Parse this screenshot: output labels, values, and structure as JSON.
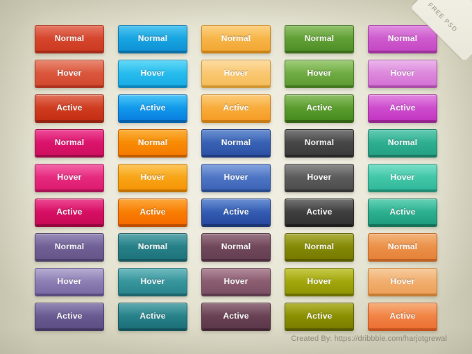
{
  "ribbon": {
    "label": "FREE PSD"
  },
  "footer": {
    "credit": "Created By: https://dribbble.com/harjotgrewal"
  },
  "background": {
    "color": "#eeecdf",
    "edge_color": "#d3d1bb"
  },
  "states": [
    "Normal",
    "Hover",
    "Active"
  ],
  "columns": [
    {
      "name": "red",
      "states": {
        "normal": "Normal",
        "hover": "Hover",
        "active": "Active"
      },
      "colors": {
        "normal_top": "#df5339",
        "normal_bottom": "#cc3a21",
        "normal_base": "#a52c18",
        "hover_top": "#e2664a",
        "hover_bottom": "#d2492f",
        "hover_base": "#ab3320",
        "active_top": "#d94a2c",
        "active_bottom": "#c42f14",
        "active_base": "#962310"
      }
    },
    {
      "name": "sky-blue",
      "states": {
        "normal": "Normal",
        "hover": "Hover",
        "active": "Active"
      },
      "colors": {
        "normal_top": "#21b6ec",
        "normal_bottom": "#0f93d6",
        "normal_base": "#0b6fa6",
        "hover_top": "#36cdf5",
        "hover_bottom": "#19ace6",
        "hover_base": "#0e84b8",
        "active_top": "#19b4f5",
        "active_bottom": "#0a7fe0",
        "active_base": "#0661ab"
      }
    },
    {
      "name": "amber",
      "states": {
        "normal": "Normal",
        "hover": "Hover",
        "active": "Active"
      },
      "colors": {
        "normal_top": "#fbc461",
        "normal_bottom": "#f2a732",
        "normal_base": "#c98219",
        "hover_top": "#fcd287",
        "hover_bottom": "#f6bd5c",
        "hover_base": "#cf9633",
        "active_top": "#fbbd55",
        "active_bottom": "#f59c25",
        "active_base": "#c87a14"
      }
    },
    {
      "name": "green",
      "states": {
        "normal": "Normal",
        "hover": "Hover",
        "active": "Active"
      },
      "colors": {
        "normal_top": "#74b143",
        "normal_bottom": "#4e8f27",
        "normal_base": "#3a6c1b",
        "hover_top": "#85bf55",
        "hover_bottom": "#5d9b33",
        "hover_base": "#437722",
        "active_top": "#6fae3d",
        "active_bottom": "#478b1f",
        "active_base": "#346314"
      }
    },
    {
      "name": "orchid",
      "states": {
        "normal": "Normal",
        "hover": "Hover",
        "active": "Active"
      },
      "colors": {
        "normal_top": "#d86fd8",
        "normal_bottom": "#c548c5",
        "normal_base": "#9b339b",
        "hover_top": "#e5a0e5",
        "hover_bottom": "#d572d5",
        "hover_base": "#a94da9",
        "active_top": "#d964d9",
        "active_bottom": "#c336c3",
        "active_base": "#96248f"
      }
    },
    {
      "name": "magenta",
      "states": {
        "normal": "Normal",
        "hover": "Hover",
        "active": "Active"
      },
      "colors": {
        "normal_top": "#e8197a",
        "normal_bottom": "#cf0f5f",
        "normal_base": "#9d0a47",
        "hover_top": "#ef3b8f",
        "hover_bottom": "#dd1b6f",
        "hover_base": "#a81255",
        "active_top": "#e61574",
        "active_bottom": "#c80a55",
        "active_base": "#94063d"
      }
    },
    {
      "name": "orange",
      "states": {
        "normal": "Normal",
        "hover": "Hover",
        "active": "Active"
      },
      "colors": {
        "normal_top": "#fb9b08",
        "normal_bottom": "#f57c00",
        "normal_base": "#c05c00",
        "hover_top": "#fcb62c",
        "hover_bottom": "#f59505",
        "hover_base": "#c17200",
        "active_top": "#fb8f05",
        "active_bottom": "#f66c00",
        "active_base": "#bd4e00"
      }
    },
    {
      "name": "navy-blue",
      "states": {
        "normal": "Normal",
        "hover": "Hover",
        "active": "Active"
      },
      "colors": {
        "normal_top": "#4473c4",
        "normal_bottom": "#2c51a5",
        "normal_base": "#1f3b7d",
        "hover_top": "#628ad4",
        "hover_bottom": "#3c63b6",
        "hover_base": "#2a4a8c",
        "active_top": "#4070c6",
        "active_bottom": "#27499f",
        "active_base": "#1a3572"
      }
    },
    {
      "name": "charcoal",
      "states": {
        "normal": "Normal",
        "hover": "Hover",
        "active": "Active"
      },
      "colors": {
        "normal_top": "#545454",
        "normal_bottom": "#3b3b3b",
        "normal_base": "#272727",
        "hover_top": "#6b6b6b",
        "hover_bottom": "#4d4d4d",
        "hover_base": "#333333",
        "active_top": "#4c4c4c",
        "active_bottom": "#323232",
        "active_base": "#1e1e1e"
      }
    },
    {
      "name": "teal-mint",
      "states": {
        "normal": "Normal",
        "hover": "Hover",
        "active": "Active"
      },
      "colors": {
        "normal_top": "#39bd9e",
        "normal_bottom": "#25a184",
        "normal_base": "#197a63",
        "hover_top": "#54d6b8",
        "hover_bottom": "#32b89a",
        "hover_base": "#1f8c73",
        "active_top": "#3ac4a2",
        "active_bottom": "#1f9d7f",
        "active_base": "#147259"
      }
    },
    {
      "name": "purple",
      "states": {
        "normal": "Normal",
        "hover": "Hover",
        "active": "Active"
      },
      "colors": {
        "normal_top": "#7b6ba3",
        "normal_bottom": "#655588",
        "normal_base": "#4b3e68",
        "hover_top": "#a194c4",
        "hover_bottom": "#7a6ba5",
        "hover_base": "#594c7f",
        "active_top": "#7566a0",
        "active_bottom": "#5d4f84",
        "active_base": "#433762"
      }
    },
    {
      "name": "deep-teal",
      "states": {
        "normal": "Normal",
        "hover": "Hover",
        "active": "Active"
      },
      "colors": {
        "normal_top": "#2f8e95",
        "normal_bottom": "#1e737c",
        "normal_base": "#165860",
        "hover_top": "#46a7ad",
        "hover_bottom": "#2a858d",
        "hover_base": "#1c656d",
        "active_top": "#31939a",
        "active_bottom": "#1d7078",
        "active_base": "#12535b"
      }
    },
    {
      "name": "wine",
      "states": {
        "normal": "Normal",
        "hover": "Hover",
        "active": "Active"
      },
      "colors": {
        "normal_top": "#7d5164",
        "normal_bottom": "#653f52",
        "normal_base": "#4b2d3d",
        "hover_top": "#9c6a7e",
        "hover_bottom": "#7b5064",
        "hover_base": "#5c3a4b",
        "active_top": "#764b5e",
        "active_bottom": "#5c384a",
        "active_base": "#422633"
      }
    },
    {
      "name": "olive",
      "states": {
        "normal": "Normal",
        "hover": "Hover",
        "active": "Active"
      },
      "colors": {
        "normal_top": "#95990b",
        "normal_bottom": "#767a00",
        "normal_base": "#585b00",
        "hover_top": "#b5ba14",
        "hover_bottom": "#909505",
        "hover_base": "#6c7000",
        "active_top": "#9ba000",
        "active_bottom": "#7a7e00",
        "active_base": "#565900"
      }
    },
    {
      "name": "coral",
      "states": {
        "normal": "Normal",
        "hover": "Hover",
        "active": "Active"
      },
      "colors": {
        "normal_top": "#f0a057",
        "normal_bottom": "#e6823a",
        "normal_base": "#bd6023",
        "hover_top": "#f5bd83",
        "hover_bottom": "#eda05a",
        "hover_base": "#c57c34",
        "active_top": "#f59756",
        "active_bottom": "#ed7034",
        "active_base": "#c2511c"
      }
    }
  ]
}
